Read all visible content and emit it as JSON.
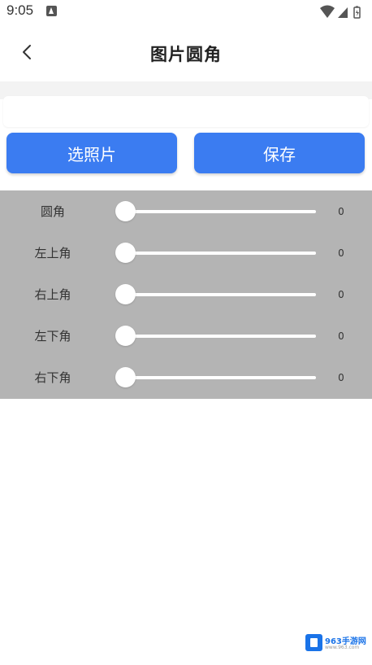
{
  "status_bar": {
    "time": "9:05",
    "notification_icon": "app-notification-icon",
    "icons": [
      "wifi-icon",
      "cellular-signal-icon",
      "battery-icon"
    ]
  },
  "header": {
    "title": "图片圆角",
    "back_icon": "chevron-left-icon"
  },
  "actions": {
    "pick_label": "选照片",
    "save_label": "保存",
    "accent_color": "#3b7cf1"
  },
  "sliders": [
    {
      "label": "圆角",
      "value": "0"
    },
    {
      "label": "左上角",
      "value": "0"
    },
    {
      "label": "右上角",
      "value": "0"
    },
    {
      "label": "左下角",
      "value": "0"
    },
    {
      "label": "右下角",
      "value": "0"
    }
  ],
  "watermark": {
    "text": "963手游网",
    "sub": "www.963.com"
  }
}
